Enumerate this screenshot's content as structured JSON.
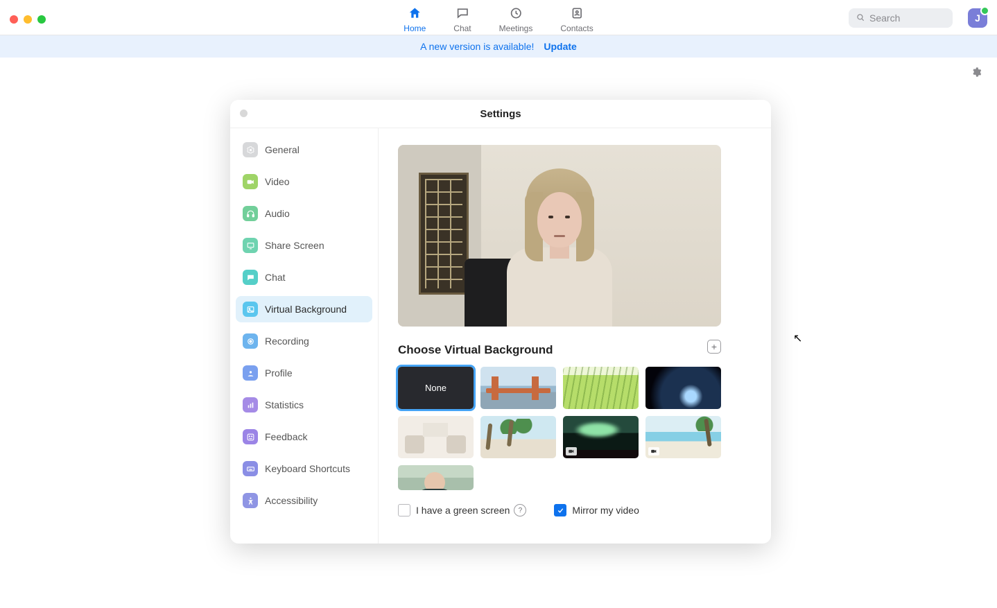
{
  "colors": {
    "accent": "#0e72ed"
  },
  "tabs": [
    {
      "id": "home",
      "label": "Home",
      "active": true
    },
    {
      "id": "chat",
      "label": "Chat",
      "active": false
    },
    {
      "id": "meetings",
      "label": "Meetings",
      "active": false
    },
    {
      "id": "contacts",
      "label": "Contacts",
      "active": false
    }
  ],
  "search": {
    "placeholder": "Search"
  },
  "avatar": {
    "initial": "J"
  },
  "banner": {
    "message": "A new version is available!",
    "action": "Update"
  },
  "settings": {
    "title": "Settings",
    "sidebar": [
      {
        "id": "general",
        "label": "General",
        "icon": "gear",
        "color": "#d7d8da",
        "active": false
      },
      {
        "id": "video",
        "label": "Video",
        "icon": "video",
        "color": "#9fd467",
        "active": false
      },
      {
        "id": "audio",
        "label": "Audio",
        "icon": "headphones",
        "color": "#72cf9a",
        "active": false
      },
      {
        "id": "share",
        "label": "Share Screen",
        "icon": "screen",
        "color": "#6fd3b0",
        "active": false
      },
      {
        "id": "chat",
        "label": "Chat",
        "icon": "chat",
        "color": "#55cfc8",
        "active": false
      },
      {
        "id": "vbg",
        "label": "Virtual Background",
        "icon": "image",
        "color": "#5bc6ee",
        "active": true
      },
      {
        "id": "recording",
        "label": "Recording",
        "icon": "record",
        "color": "#6db4ee",
        "active": false
      },
      {
        "id": "profile",
        "label": "Profile",
        "icon": "person",
        "color": "#7aa0ef",
        "active": false
      },
      {
        "id": "statistics",
        "label": "Statistics",
        "icon": "stats",
        "color": "#a58be6",
        "active": false
      },
      {
        "id": "feedback",
        "label": "Feedback",
        "icon": "smile",
        "color": "#9b84e6",
        "active": false
      },
      {
        "id": "shortcuts",
        "label": "Keyboard Shortcuts",
        "icon": "keyboard",
        "color": "#8a8ee5",
        "active": false
      },
      {
        "id": "accessibility",
        "label": "Accessibility",
        "icon": "accessibility",
        "color": "#8f95e4",
        "active": false
      }
    ],
    "vbg": {
      "section_title": "Choose Virtual Background",
      "add_tooltip": "Add Image or Video",
      "none_label": "None",
      "backgrounds": [
        {
          "id": "none",
          "type": "none",
          "selected": true
        },
        {
          "id": "bridge",
          "type": "image",
          "selected": false
        },
        {
          "id": "grass",
          "type": "image",
          "selected": false
        },
        {
          "id": "space",
          "type": "image",
          "selected": false
        },
        {
          "id": "office",
          "type": "image",
          "selected": false
        },
        {
          "id": "palm1",
          "type": "image",
          "selected": false
        },
        {
          "id": "aurora",
          "type": "video",
          "selected": false
        },
        {
          "id": "beach",
          "type": "video",
          "selected": false
        },
        {
          "id": "user",
          "type": "image",
          "selected": false
        }
      ],
      "green_screen": {
        "label": "I have a green screen",
        "checked": false
      },
      "mirror": {
        "label": "Mirror my video",
        "checked": true
      }
    }
  }
}
